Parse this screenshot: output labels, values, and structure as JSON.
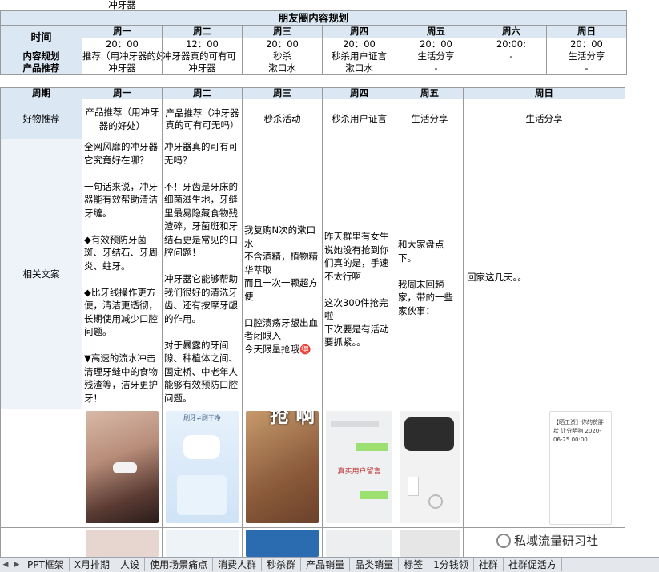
{
  "top_cell": "冲牙器",
  "plan": {
    "title": "朋友圈内容规划",
    "time_label": "时间",
    "days": [
      "周一",
      "周二",
      "周三",
      "周四",
      "周五",
      "周六",
      "周日"
    ],
    "times": [
      "20：00",
      "12：00",
      "20：00",
      "20：00",
      "20：00",
      "20:00:",
      "20：00"
    ],
    "content_label": "内容规划",
    "content": [
      "推荐（用冲牙器的好",
      "冲牙器真的可有可",
      "秒杀",
      "秒杀用户证言",
      "生活分享",
      "-",
      "生活分享"
    ],
    "product_label": "产品推荐",
    "products": [
      "冲牙器",
      "冲牙器",
      "漱口水",
      "漱口水",
      "-",
      "",
      "-"
    ]
  },
  "weekly": {
    "period_label": "周期",
    "days": [
      "周一",
      "周二",
      "周三",
      "周四",
      "周五",
      "周日"
    ],
    "rec_label": "好物推荐",
    "recs": [
      "产品推荐（用冲牙器的好处）",
      "产品推荐（冲牙器真的可有可无吗）",
      "秒杀活动",
      "秒杀用户证言",
      "生活分享",
      "生活分享"
    ],
    "copy_label": "相关文案",
    "copy": [
      "全网风靡的冲牙器它究竟好在哪？\n\n一句话来说，冲牙器能有效帮助清洁牙缝。\n\n◆有效预防牙菌斑、牙结石、牙周炎、蛀牙。\n\n◆比牙线操作更方便，清洁更透彻，长期使用减少口腔问题。\n\n▼高速的流水冲击清理牙缝中的食物残渣等，洁牙更护牙！",
      "冲牙器真的可有可无吗？\n\n不！牙齿是牙床的细菌滋生地，牙缝里最易隐藏食物残渣碎，牙菌斑和牙结石更是常见的口腔问题！\n\n冲牙器它能够帮助我们很好的清洗牙齿、还有按摩牙龈的作用。\n\n对于暴露的牙间隙、种植体之间、固定桥、中老年人能够有效预防口腔问题。",
      "我复购N次的漱口水\n不含酒精，植物精华萃取\n而且一次一颗超方便\n\n口腔溃疡牙龈出血者闭眼入\n今天限量抢哦🉐",
      "昨天群里有女生说她没有抢到你们真的是，手速不太行啊\n\n这次300件抢完啦\n下次要是有活动要抓紧。。",
      "和大家盘点一下。\n\n我周末回趟家，带的一些家伙事：",
      "回家这几天。。"
    ]
  },
  "images": {
    "img1_text": "",
    "img2_text": "刷牙≠刷干净",
    "img3_text": "抢 啊 啊",
    "img4_text": "真实用户留言",
    "img6_text": "【晒工资】你的贫胖状 让分明物 2020-06-25 00:00 ..."
  },
  "sheet_tabs": [
    "PPT框架",
    "X月排期",
    "人设",
    "使用场景痛点",
    "消费人群",
    "秒杀群",
    "产品销量",
    "品类销量",
    "标签",
    "1分钱领",
    "社群",
    "社群促活方"
  ],
  "watermark": "私域流量研习社",
  "colors": {
    "header": "#dbe8f4",
    "tabbar": "#e4e7ec"
  }
}
